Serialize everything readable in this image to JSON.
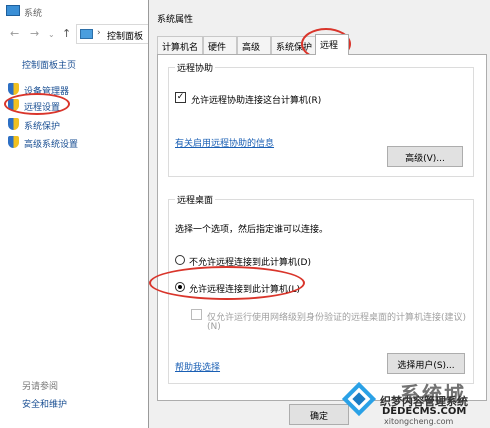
{
  "background_window": {
    "title": "系统",
    "breadcrumb": "控制面板",
    "home_link": "控制面板主页",
    "side_links": [
      "设备管理器",
      "远程设置",
      "系统保护",
      "高级系统设置"
    ],
    "see_also_label": "另请参阅",
    "security_link": "安全和维护"
  },
  "dialog": {
    "title": "系统属性",
    "tabs": [
      "计算机名",
      "硬件",
      "高级",
      "系统保护",
      "远程"
    ],
    "active_tab": "远程",
    "remote_assistance": {
      "group_label": "远程协助",
      "allow_label": "允许远程协助连接这台计算机(R)",
      "allow_checked": true,
      "info_link": "有关启用远程协助的信息",
      "advanced_button": "高级(V)..."
    },
    "remote_desktop": {
      "group_label": "远程桌面",
      "instruction": "选择一个选项，然后指定谁可以连接。",
      "option_deny": "不允许远程连接到此计算机(D)",
      "option_allow": "允许远程连接到此计算机(L)",
      "selected": "allow",
      "nla_label_line1": "仅允许运行使用网络级别身份验证的远程桌面的计算机连接(建议)",
      "nla_label_line2": "(N)",
      "help_link": "帮助我选择",
      "select_users_button": "选择用户(S)..."
    },
    "ok_button": "确定"
  },
  "watermark": {
    "brand": "系统城",
    "slogan": "织梦内容管理系统",
    "site1": "DEDECMS.COM",
    "site2": "xitongcheng.com"
  },
  "colors": {
    "annotation_red": "#d9352b",
    "link_blue": "#1a5fb4",
    "dialog_bg": "#f0f0f0"
  }
}
